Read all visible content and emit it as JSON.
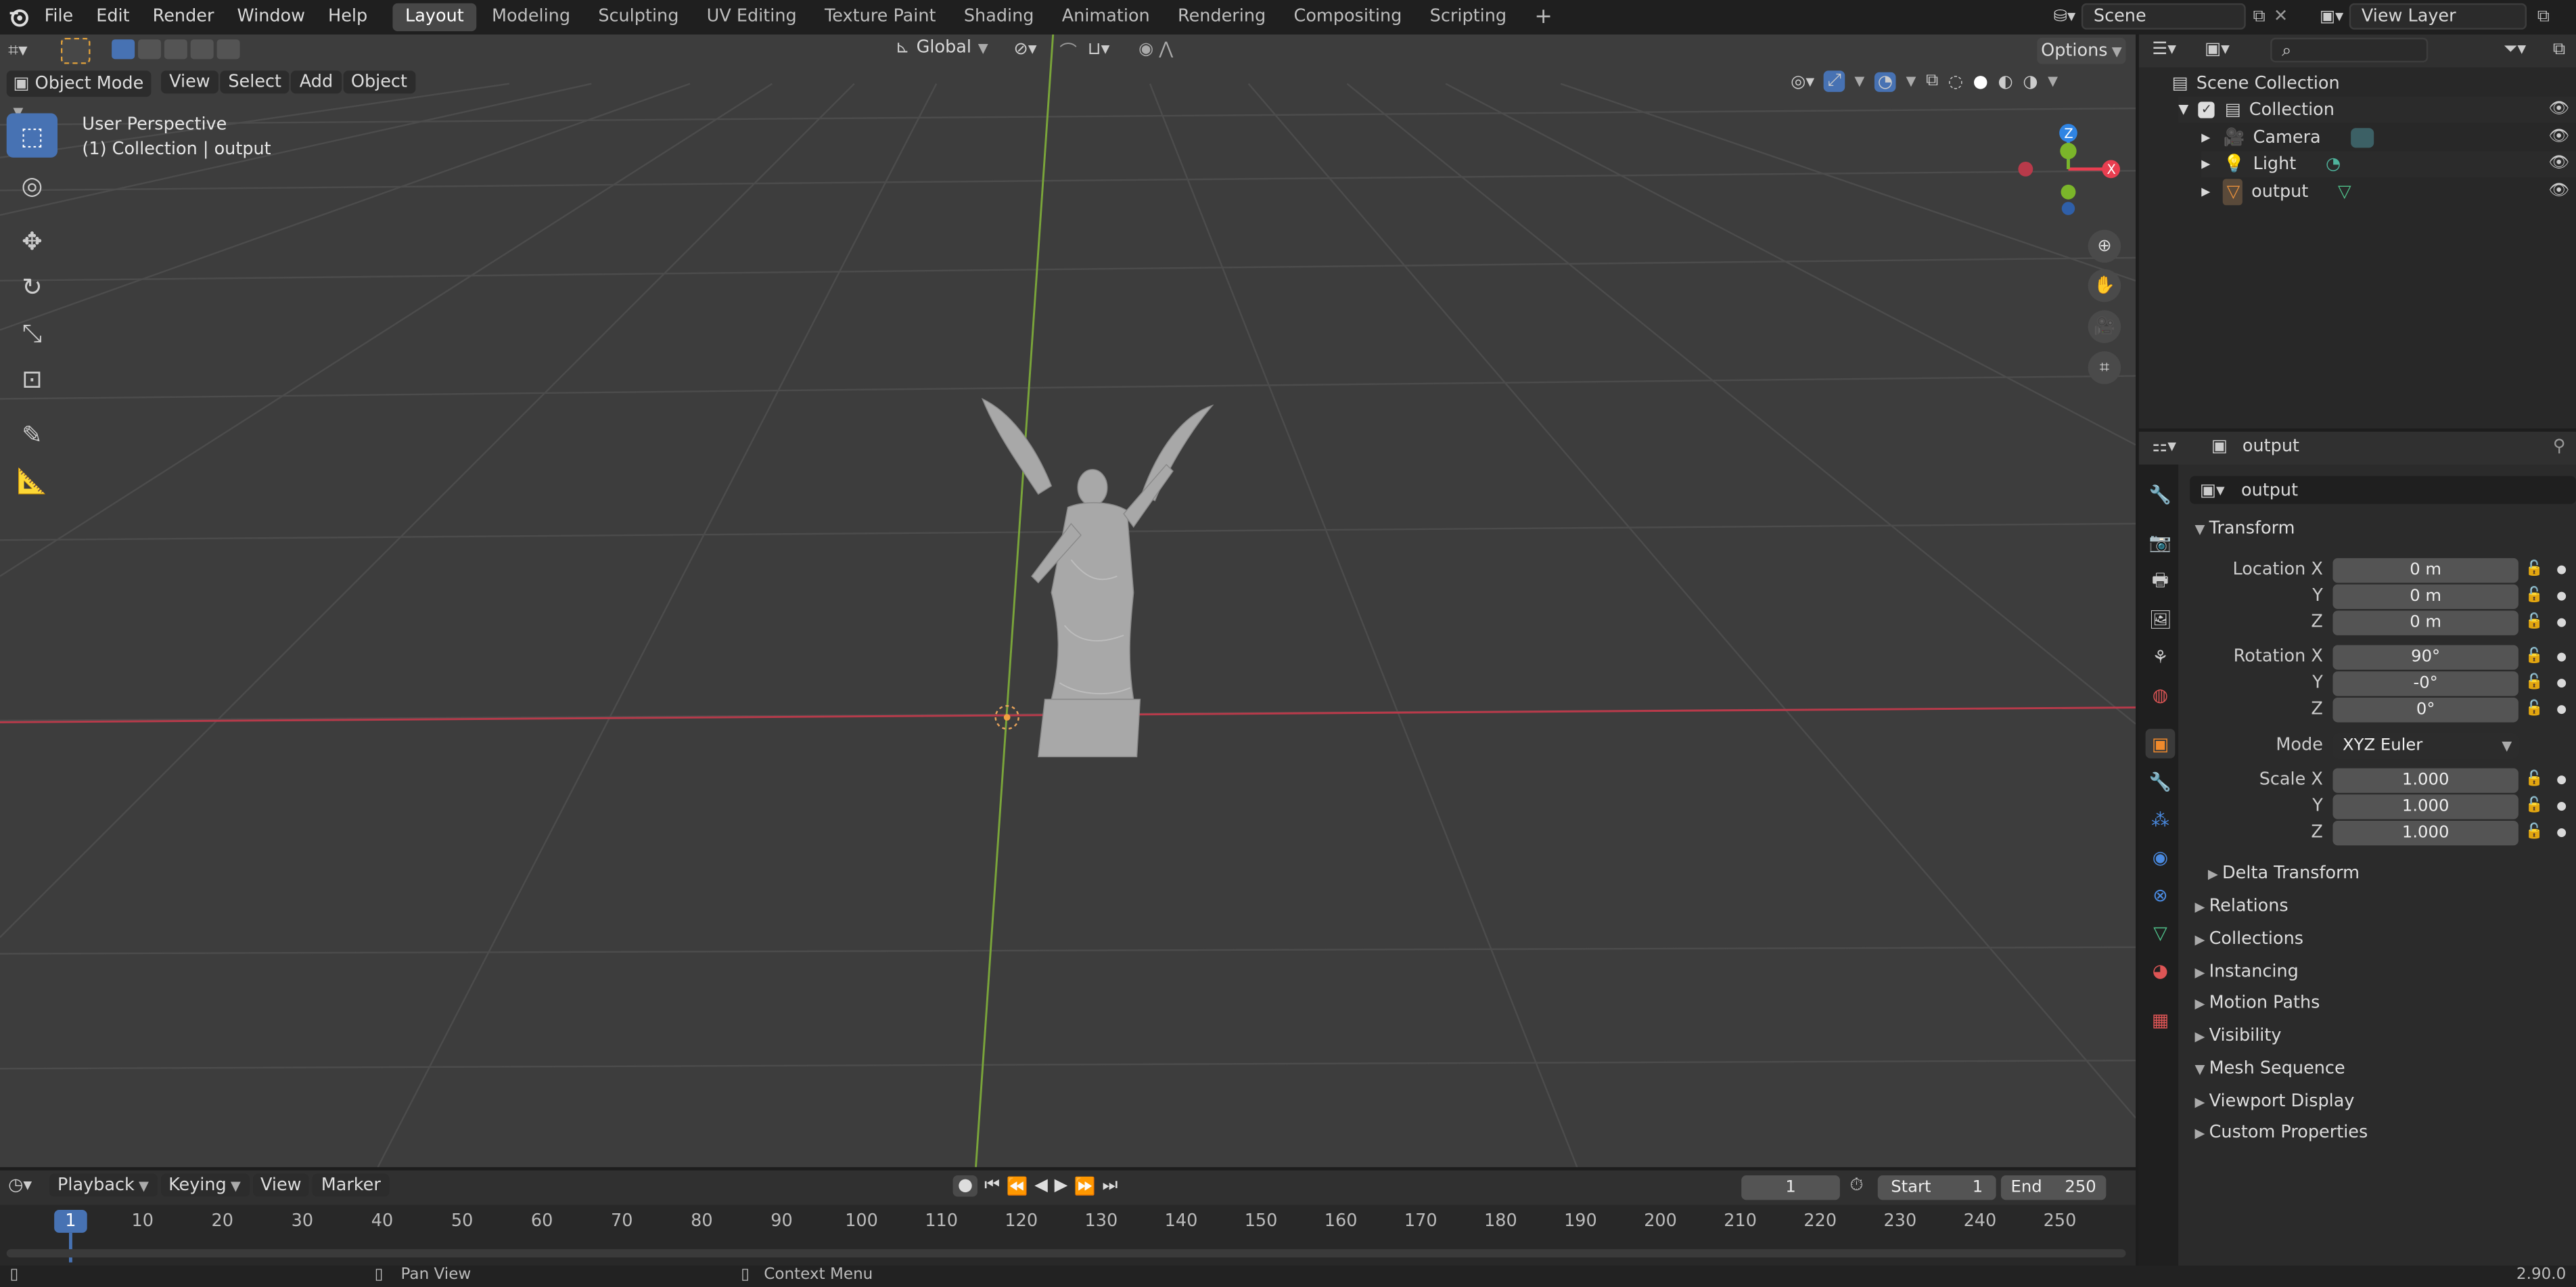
{
  "topbar": {
    "menus": [
      "File",
      "Edit",
      "Render",
      "Window",
      "Help"
    ],
    "workspaces": [
      "Layout",
      "Modeling",
      "Sculpting",
      "UV Editing",
      "Texture Paint",
      "Shading",
      "Animation",
      "Rendering",
      "Compositing",
      "Scripting"
    ],
    "active_workspace": "Layout",
    "add_workspace": "+",
    "scene": "Scene",
    "view_layer": "View Layer"
  },
  "viewport": {
    "mode": "Object Mode",
    "menus": [
      "View",
      "Select",
      "Add",
      "Object"
    ],
    "orientation": "Global",
    "options": "Options",
    "overlay_title": "User Perspective",
    "overlay_sub": "(1) Collection | output",
    "gizmo": {
      "z": "Z",
      "x": "X"
    }
  },
  "outliner": {
    "search_placeholder": "",
    "root": "Scene Collection",
    "collection": "Collection",
    "items": [
      "Camera",
      "Light",
      "output"
    ]
  },
  "properties": {
    "header_object": "output",
    "object_name": "output",
    "transform_title": "Transform",
    "location": {
      "label": "Location X",
      "x": "0 m",
      "y": "0 m",
      "z": "0 m"
    },
    "rotation": {
      "label": "Rotation X",
      "x": "90°",
      "y": "-0°",
      "z": "0°"
    },
    "mode_label": "Mode",
    "mode_value": "XYZ Euler",
    "scale": {
      "label": "Scale X",
      "x": "1.000",
      "y": "1.000",
      "z": "1.000"
    },
    "axis_y": "Y",
    "axis_z": "Z",
    "delta": "Delta Transform",
    "sections": [
      "Relations",
      "Collections",
      "Instancing",
      "Motion Paths",
      "Visibility",
      "Mesh Sequence",
      "Viewport Display",
      "Custom Properties"
    ]
  },
  "timeline": {
    "menus": [
      "Playback",
      "Keying",
      "View",
      "Marker"
    ],
    "current_frame": "1",
    "start_label": "Start",
    "start": "1",
    "end_label": "End",
    "end": "250",
    "ticks": [
      "1",
      "10",
      "20",
      "30",
      "40",
      "50",
      "60",
      "70",
      "80",
      "90",
      "100",
      "110",
      "120",
      "130",
      "140",
      "150",
      "160",
      "170",
      "180",
      "190",
      "200",
      "210",
      "220",
      "230",
      "240",
      "250"
    ]
  },
  "statusbar": {
    "pan": "Pan View",
    "context": "Context Menu",
    "version": "2.90.0"
  },
  "colors": {
    "x_axis": "#b83a4a",
    "y_axis": "#7aa53a",
    "accent": "#4772b3",
    "gizmo_x": "#e83e50",
    "gizmo_y": "#7bb52a",
    "gizmo_z": "#2f84e3"
  }
}
